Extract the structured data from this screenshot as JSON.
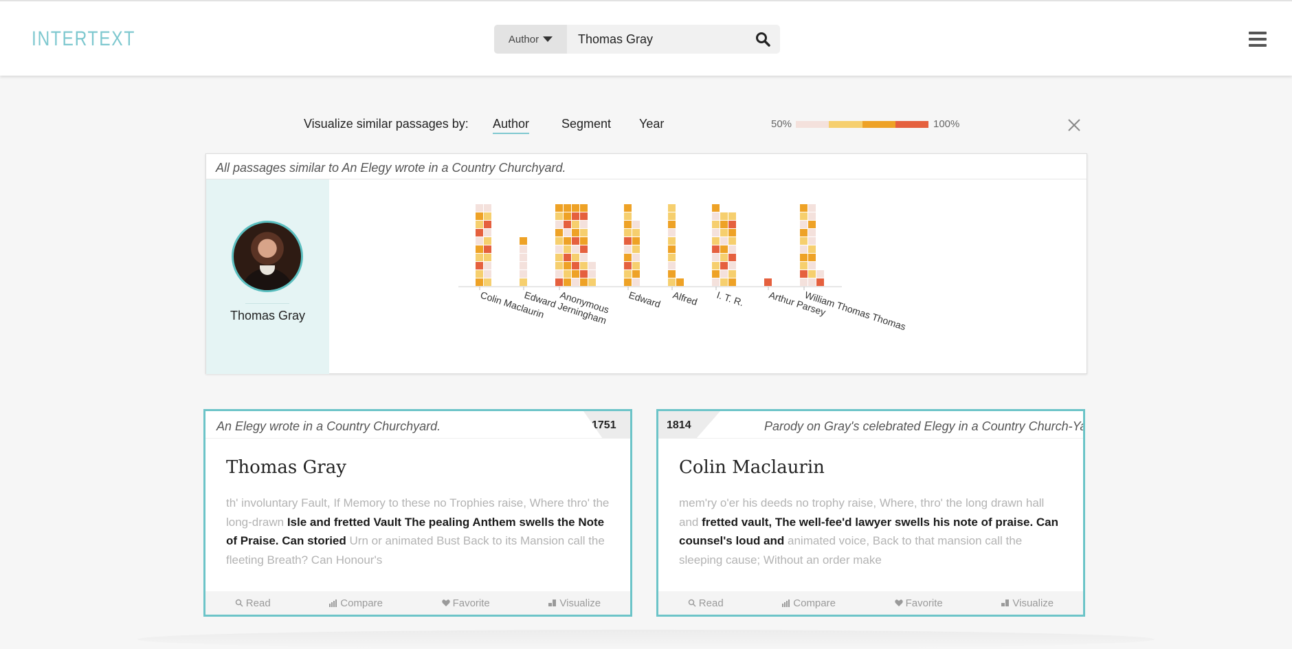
{
  "header": {
    "logo": "INTERTEXT",
    "search": {
      "field_label": "Author",
      "query": "Thomas Gray"
    }
  },
  "viz": {
    "label": "Visualize similar passages by:",
    "tabs": [
      {
        "label": "Author",
        "active": true
      },
      {
        "label": "Segment",
        "active": false
      },
      {
        "label": "Year",
        "active": false
      }
    ],
    "scale": {
      "low": "50%",
      "high": "100%",
      "colors": [
        "#f4e1dc",
        "#f6cf6e",
        "#eea226",
        "#e5603e"
      ]
    },
    "caption": "All passages similar to An Elegy wrote in a Country Churchyard.",
    "author": "Thomas Gray"
  },
  "chart_data": {
    "type": "heatmap",
    "categories": [
      "Colin Maclaurin",
      "Edward Jerningham",
      "Anonymous",
      "Edward",
      "Alfred",
      "I. T. R.",
      "Arthur Parsey",
      "William Thomas Thomas"
    ],
    "legend_levels": [
      "50%",
      "100%"
    ],
    "groups": [
      {
        "author": "Colin Maclaurin",
        "columns": [
          [
            3,
            2,
            4,
            2,
            3,
            1,
            4,
            2,
            3,
            1
          ],
          [
            2,
            1,
            1,
            2,
            4,
            2,
            1,
            4,
            2,
            1
          ]
        ]
      },
      {
        "author": "Edward Jerningham",
        "columns": [
          [
            2,
            1,
            1,
            1,
            1,
            3
          ]
        ]
      },
      {
        "author": "Anonymous",
        "columns": [
          [
            4,
            1,
            2,
            2,
            1,
            2,
            3,
            1,
            2,
            3
          ],
          [
            3,
            2,
            3,
            4,
            2,
            3,
            1,
            4,
            3,
            3
          ],
          [
            1,
            3,
            4,
            2,
            1,
            4,
            3,
            2,
            4,
            3
          ],
          [
            3,
            4,
            2,
            1,
            4,
            3,
            2,
            1,
            4,
            3
          ],
          [
            2,
            1,
            1
          ]
        ]
      },
      {
        "author": "Edward",
        "columns": [
          [
            3,
            2,
            4,
            3,
            1,
            4,
            2,
            3,
            2,
            3
          ],
          [
            1,
            3,
            2,
            1,
            2,
            3,
            2,
            1
          ]
        ]
      },
      {
        "author": "Alfred",
        "columns": [
          [
            2,
            3,
            1,
            2,
            3,
            2,
            1,
            3,
            2,
            2
          ],
          [
            3
          ]
        ]
      },
      {
        "author": "I. T. R.",
        "columns": [
          [
            1,
            3,
            2,
            1,
            4,
            2,
            1,
            2,
            1,
            3
          ],
          [
            2,
            1,
            4,
            2,
            3,
            1,
            2,
            3,
            2
          ],
          [
            3,
            2,
            1,
            4,
            1,
            2,
            3,
            4,
            2
          ]
        ]
      },
      {
        "author": "Arthur Parsey",
        "columns": [
          [
            4
          ]
        ]
      },
      {
        "author": "William Thomas Thomas",
        "columns": [
          [
            1,
            4,
            2,
            3,
            1,
            2,
            3,
            1,
            2,
            3
          ],
          [
            1,
            2,
            1,
            3,
            2,
            1,
            1,
            3,
            1,
            1
          ],
          [
            4,
            1
          ]
        ]
      }
    ]
  },
  "cards": [
    {
      "title": "An Elegy wrote in a Country Churchyard.",
      "year": "1751",
      "author": "Thomas Gray",
      "text_pre": "th' involuntary Fault, If Memory to these no Trophies raise, Where thro' the long-drawn ",
      "text_match": "Isle and fretted Vault The pealing Anthem swells the Note of Praise. Can storied",
      "text_post": " Urn or animated Bust Back to its Mansion call the fleeting Breath? Can Honour's"
    },
    {
      "title": "Parody on Gray's celebrated Elegy in a Country Church-Yard",
      "year": "1814",
      "author": "Colin Maclaurin",
      "text_pre": "mem'ry o'er his deeds no trophy raise, Where, thro' the long drawn hall and ",
      "text_match": "fretted vault, The well-fee'd lawyer swells his note of praise. Can counsel's loud and",
      "text_post": " animated voice, Back to that mansion call the sleeping cause; Without an order make"
    }
  ],
  "actions": {
    "read": "Read",
    "compare": "Compare",
    "favorite": "Favorite",
    "visualize": "Visualize"
  }
}
